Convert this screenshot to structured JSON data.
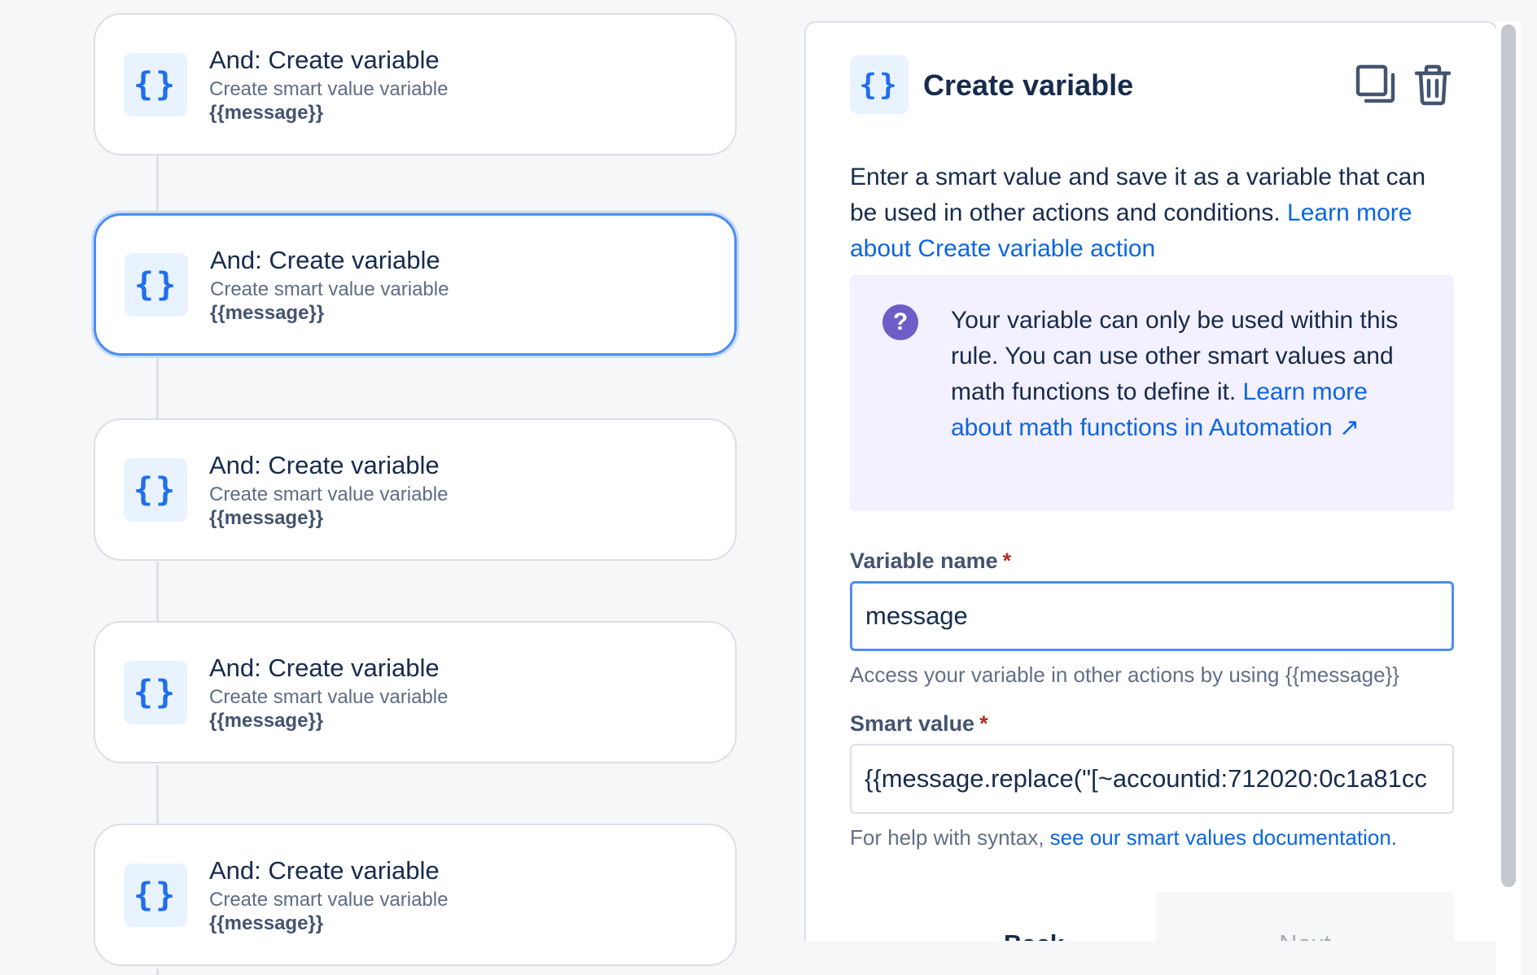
{
  "flow": {
    "cards": [
      {
        "title": "And: Create variable",
        "subtitle": "Create smart value variable",
        "variable": "{{message}}",
        "icon": "curly-braces-icon"
      },
      {
        "title": "And: Create variable",
        "subtitle": "Create smart value variable",
        "variable": "{{message}}",
        "icon": "curly-braces-icon"
      },
      {
        "title": "And: Create variable",
        "subtitle": "Create smart value variable",
        "variable": "{{message}}",
        "icon": "curly-braces-icon"
      },
      {
        "title": "And: Create variable",
        "subtitle": "Create smart value variable",
        "variable": "{{message}}",
        "icon": "curly-braces-icon"
      },
      {
        "title": "And: Create variable",
        "subtitle": "Create smart value variable",
        "variable": "{{message}}",
        "icon": "curly-braces-icon"
      }
    ],
    "selected_index": 1
  },
  "panel": {
    "icon_glyph": "{}",
    "title": "Create variable",
    "description": "Enter a smart value and save it as a variable that can be used in other actions and conditions.",
    "description_link": "Learn more about Create variable action",
    "info_text": "Your variable can only be used within this rule. You can use other smart values and math functions to define it.",
    "info_link": "Learn more about math functions in Automation ↗",
    "info_icon_glyph": "?",
    "variable_name": {
      "label": "Variable name",
      "required_marker": "*",
      "value": "message",
      "help": "Access your variable in other actions by using {{message}}"
    },
    "smart_value": {
      "label": "Smart value",
      "required_marker": "*",
      "value": "{{message.replace(\"[~accountid:712020:0c1a81cc",
      "help": "For help with syntax,",
      "help_link": "see our smart values documentation."
    },
    "buttons": {
      "back": "Back",
      "next": "Next"
    }
  },
  "colors": {
    "accent": "#4c8cf5",
    "link": "#0c66e4",
    "icon_blue": "#1f6feb",
    "info_bg": "#f3f0ff",
    "info_icon": "#6e5dc6",
    "required": "#ae2e24"
  }
}
